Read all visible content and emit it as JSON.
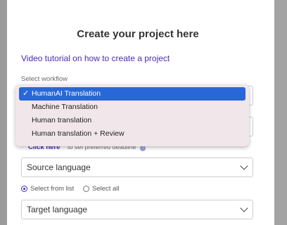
{
  "modal": {
    "title": "Create your project here",
    "tutorial_link": "Video tutorial on how to create a project",
    "workflow_label": "Select workflow",
    "deadline": {
      "click_here": "Click here",
      "hint": "to set preferred deadline",
      "help_icon_glyph": "?"
    },
    "source_language": "Source language",
    "target_language": "Target language",
    "radio": {
      "select_from_list": "Select from list",
      "select_all": "Select all",
      "selected": "select_from_list"
    }
  },
  "workflow_dropdown": {
    "check_glyph": "✓",
    "options": [
      {
        "label": "HumanAI Translation",
        "selected": true
      },
      {
        "label": "Machine Translation",
        "selected": false
      },
      {
        "label": "Human translation",
        "selected": false
      },
      {
        "label": "Human translation + Review",
        "selected": false
      }
    ]
  },
  "colors": {
    "link": "#4b2bb8",
    "selected_option_bg": "#2867d8",
    "dropdown_bg": "#f1e6ea",
    "radio_accent": "#3b2be0"
  }
}
